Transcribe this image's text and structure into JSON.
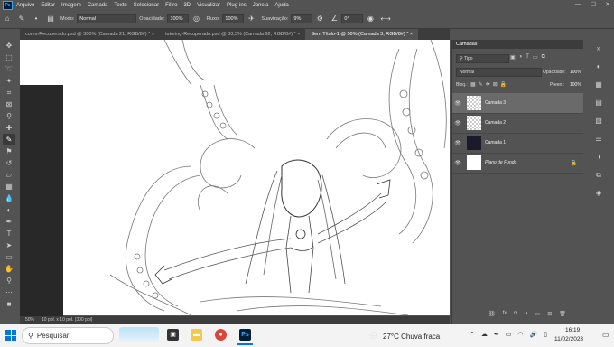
{
  "menu": {
    "logo": "Ps",
    "items": [
      "Arquivo",
      "Editar",
      "Imagem",
      "Camada",
      "Texto",
      "Selecionar",
      "Filtro",
      "3D",
      "Visualizar",
      "Plug-ins",
      "Janela",
      "Ajuda"
    ]
  },
  "options": {
    "mode_label": "Modo:",
    "mode_value": "Normal",
    "opacity_label": "Opacidade:",
    "opacity_value": "100%",
    "flow_label": "Fluxo:",
    "flow_value": "100%",
    "smoothing_label": "Suavização:",
    "smoothing_value": "9%",
    "angle_value": "0°"
  },
  "tabs": [
    {
      "label": "cores-Recuperado.psd @ 300% (Camada 21, RGB/8#) *",
      "close": "×"
    },
    {
      "label": "tutoring-Recuperado.psd @ 33,3% (Camada 92, RGB/8#) *",
      "close": "×"
    },
    {
      "label": "Sem Título-1 @ 50% (Camada 3, RGB/8#) *",
      "close": "×"
    }
  ],
  "status": {
    "zoom": "50%",
    "doc_size": "10 pol. x 10 pol. (300 ppi)"
  },
  "layers_panel": {
    "title": "Camadas",
    "filter_kind": "Tipo",
    "blend_mode": "Normal",
    "opacity_label": "Opacidade:",
    "opacity_value": "100%",
    "lock_label": "Bloq.:",
    "fill_label": "Preen.:",
    "fill_value": "100%",
    "layers": [
      {
        "name": "Camada 3",
        "selected": true,
        "thumb": "checker"
      },
      {
        "name": "Camada 2",
        "selected": false,
        "thumb": "checker"
      },
      {
        "name": "Camada 1",
        "selected": false,
        "thumb": "dark"
      },
      {
        "name": "Plano de Fundo",
        "selected": false,
        "thumb": "white"
      }
    ]
  },
  "taskbar": {
    "search_placeholder": "Pesquisar",
    "weather": "27°C  Chuva fraca",
    "time": "16:19",
    "date": "11/02/2023"
  },
  "colors": {
    "ui_bg": "#535353",
    "panel_dark": "#3c3c3c",
    "selected_layer": "#6a6a6a",
    "ps_blue": "#31a8ff",
    "canvas": "#ffffff"
  }
}
